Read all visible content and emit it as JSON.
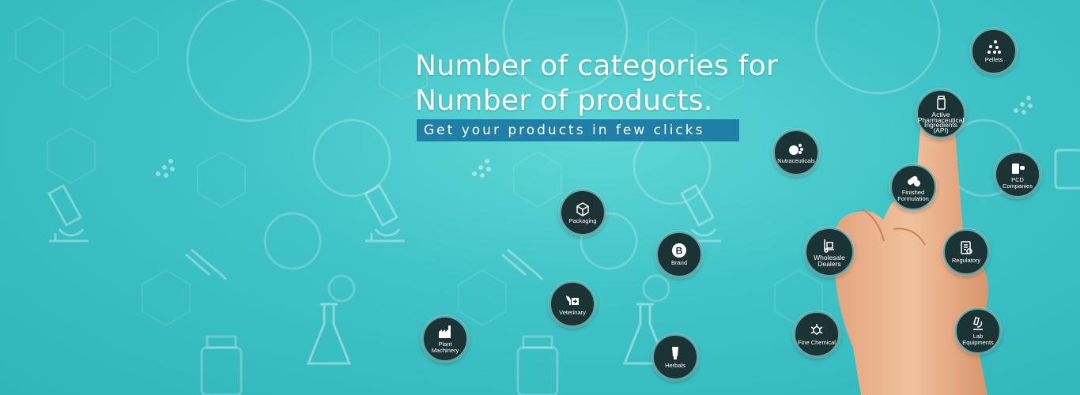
{
  "headline": {
    "line1": "Number of categories for",
    "line2": "Number of products."
  },
  "tagline": "Get your products in few clicks",
  "colors": {
    "background": "#3fc3c6",
    "tagline_bg": "#1f7fa6",
    "badge_bg": "#1c3336",
    "badge_ring": "#5fa6a6"
  },
  "categories": {
    "pellets": {
      "label": "Pellets",
      "icon": "dots-icon"
    },
    "api": {
      "label": "Active Pharmaceutical Ingredients (API)",
      "icon": "bottle-icon"
    },
    "nutraceuticals": {
      "label": "Nutraceuticals",
      "icon": "fruit-icon"
    },
    "finished_formulation": {
      "label": "Finished Formulation",
      "icon": "capsule-icon"
    },
    "pcd_companies": {
      "label": "PCD Companies",
      "icon": "medicine-box-icon"
    },
    "packaging": {
      "label": "Packaging",
      "icon": "box-icon"
    },
    "brand": {
      "label": "Brand",
      "icon": "letter-b-icon"
    },
    "wholesale_dealers": {
      "label": "Wholesale Dealers",
      "icon": "hand-truck-icon"
    },
    "regulatory": {
      "label": "Regulatory",
      "icon": "document-icon"
    },
    "veterinary": {
      "label": "Veterinary",
      "icon": "dog-medical-icon"
    },
    "plant_machinery": {
      "label": "Plant Machinery",
      "icon": "factory-icon"
    },
    "fine_chemical": {
      "label": "Fine Chemical",
      "icon": "molecule-icon"
    },
    "lab_equipments": {
      "label": "Lab Equipments",
      "icon": "microscope-icon"
    },
    "herbals": {
      "label": "Herbals",
      "icon": "tube-icon"
    }
  }
}
